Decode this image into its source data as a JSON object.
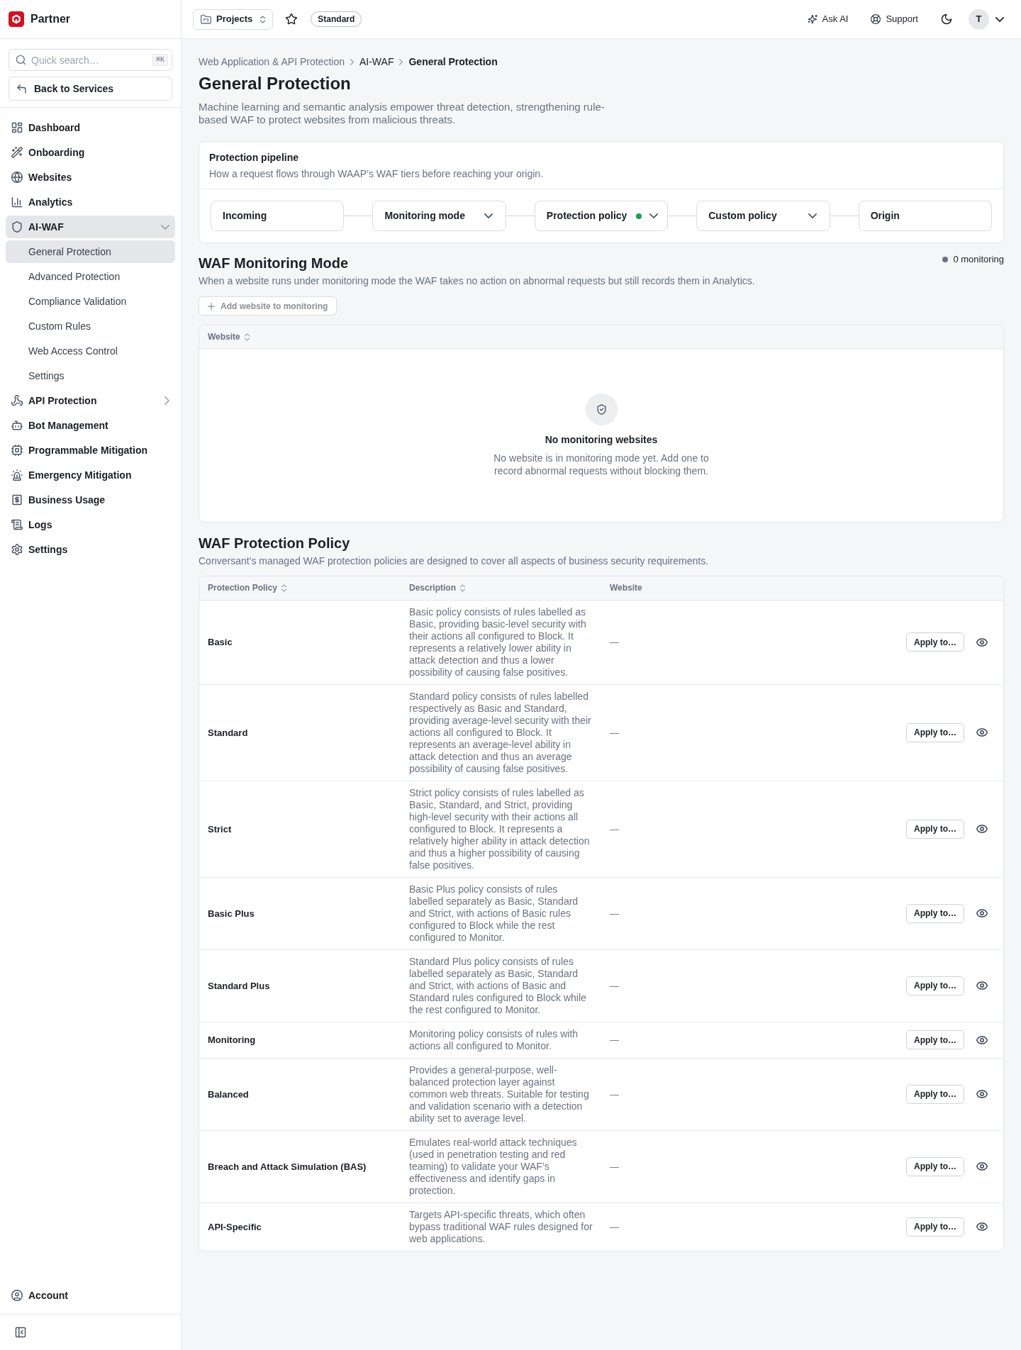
{
  "sidebar": {
    "brand": "Partner",
    "search": {
      "placeholder": "Quick search…",
      "shortcut": "⌘K"
    },
    "back_button": "Back to Services",
    "items": [
      {
        "label": "Dashboard",
        "selected": false
      },
      {
        "label": "Onboarding",
        "selected": false
      },
      {
        "label": "Websites",
        "selected": false
      },
      {
        "label": "Analytics",
        "selected": false
      },
      {
        "label": "AI-WAF",
        "selected": true,
        "expanded": true,
        "children": [
          {
            "label": "General Protection",
            "selected": true
          },
          {
            "label": "Advanced Protection",
            "selected": false
          },
          {
            "label": "Compliance Validation",
            "selected": false
          },
          {
            "label": "Custom Rules",
            "selected": false
          },
          {
            "label": "Web Access Control",
            "selected": false
          },
          {
            "label": "Settings",
            "selected": false
          }
        ]
      },
      {
        "label": "API Protection",
        "selected": false,
        "expanded": false
      },
      {
        "label": "Bot Management",
        "selected": false
      },
      {
        "label": "Programmable Mitigation",
        "selected": false
      },
      {
        "label": "Emergency Mitigation",
        "selected": false
      },
      {
        "label": "Business Usage",
        "selected": false
      },
      {
        "label": "Logs",
        "selected": false
      },
      {
        "label": "Settings",
        "selected": false
      }
    ],
    "account": "Account"
  },
  "topbar": {
    "project_button": "Projects",
    "plan_badge": "Standard",
    "actions": [
      {
        "label": "Ask AI"
      },
      {
        "label": "Support"
      }
    ],
    "avatar": "T"
  },
  "breadcrumb": [
    "Web Application & API Protection",
    "AI-WAF",
    "General Protection"
  ],
  "page": {
    "title": "General Protection",
    "description": "Machine learning and semantic analysis empower threat detection, strengthening rule-based WAF to protect websites from malicious threats."
  },
  "pipeline": {
    "title": "Protection pipeline",
    "subtitle": "How a request flows through WAAP’s WAF tiers before reaching your origin.",
    "stages": [
      {
        "label": "Incoming",
        "kind": "endpoint",
        "active": false
      },
      {
        "label": "Monitoring mode",
        "kind": "dropdown",
        "active": false
      },
      {
        "label": "Protection policy",
        "kind": "dropdown",
        "active": true
      },
      {
        "label": "Custom policy",
        "kind": "dropdown",
        "active": false
      },
      {
        "label": "Origin",
        "kind": "endpoint",
        "active": false
      }
    ]
  },
  "monitoring": {
    "title": "WAF Monitoring Mode",
    "count": "0 monitoring",
    "description": "When a website runs under monitoring mode the WAF takes no action on abnormal requests but still records them in Analytics.",
    "add_button": {
      "label": "Add website to monitoring",
      "disabled": true
    },
    "table": {
      "columns": [
        {
          "label": "Website",
          "sortable": true
        }
      ],
      "empty": {
        "title": "No monitoring websites",
        "text": "No website is in monitoring mode yet. Add one to record abnormal requests without blocking them."
      }
    }
  },
  "policy": {
    "title": "WAF Protection Policy",
    "description": "Conversant’s managed WAF protection policies are designed to cover all aspects of business security requirements.",
    "table": {
      "columns": [
        {
          "label": "Protection Policy",
          "sortable": true
        },
        {
          "label": "Description",
          "sortable": true
        },
        {
          "label": "Website",
          "sortable": false
        }
      ],
      "rows": [
        {
          "name": "Basic",
          "description": "Basic policy consists of rules labelled as Basic, providing basic-level security with their actions all configured to Block. It represents a relatively lower ability in attack detection and thus a lower possibility of causing false positives.",
          "website": "—",
          "action": "Apply to…"
        },
        {
          "name": "Standard",
          "description": "Standard policy consists of rules labelled respectively as Basic and Standard, providing average-level security with their actions all configured to Block. It represents an average-level ability in attack detection and thus an average possibility of causing false positives.",
          "website": "—",
          "action": "Apply to…"
        },
        {
          "name": "Strict",
          "description": "Strict policy consists of rules labelled as Basic, Standard, and Strict, providing high-level security with their actions all configured to Block. It represents a relatively higher ability in attack detection and thus a higher possibility of causing false positives.",
          "website": "—",
          "action": "Apply to…"
        },
        {
          "name": "Basic Plus",
          "description": "Basic Plus policy consists of rules labelled separately as Basic, Standard and Strict, with actions of Basic rules configured to Block while the rest configured to Monitor.",
          "website": "—",
          "action": "Apply to…"
        },
        {
          "name": "Standard Plus",
          "description": "Standard Plus policy consists of rules labelled separately as Basic, Standard and Strict, with actions of Basic and Standard rules configured to Block while the rest configured to Monitor.",
          "website": "—",
          "action": "Apply to…"
        },
        {
          "name": "Monitoring",
          "description": "Monitoring policy consists of rules with actions all configured to Monitor.",
          "website": "—",
          "action": "Apply to…"
        },
        {
          "name": "Balanced",
          "description": "Provides a general-purpose, well-balanced protection layer against common web threats. Suitable for testing and validation scenario with a detection ability set to average level.",
          "website": "—",
          "action": "Apply to…"
        },
        {
          "name": "Breach and Attack Simulation (BAS)",
          "description": "Emulates real-world attack techniques (used in penetration testing and red teaming) to validate your WAF’s effectiveness and identify gaps in protection.",
          "website": "—",
          "action": "Apply to…"
        },
        {
          "name": "API-Specific",
          "description": "Targets API-specific threats, which often bypass traditional WAF rules designed for web applications.",
          "website": "—",
          "action": "Apply to…"
        }
      ]
    }
  }
}
